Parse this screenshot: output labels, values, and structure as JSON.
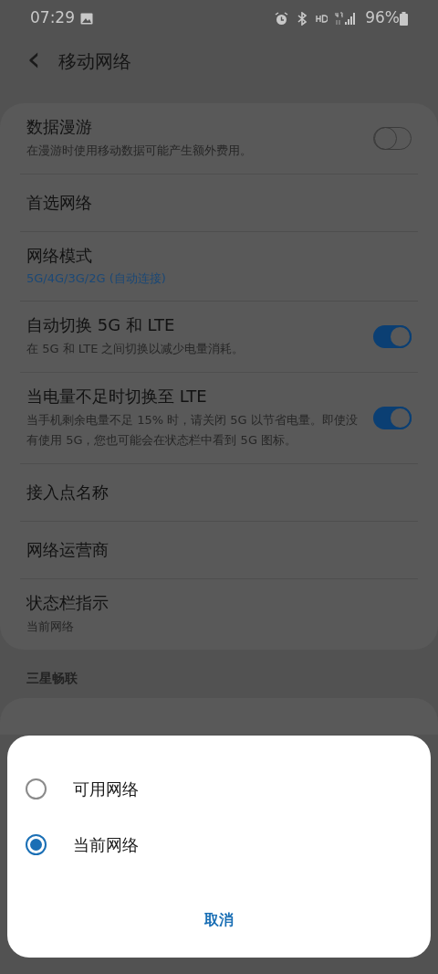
{
  "status_bar": {
    "time": "07:29",
    "battery": "96%"
  },
  "header": {
    "back": "‹",
    "title": "移动网络"
  },
  "settings": [
    {
      "kind": "toggle",
      "title": "数据漫游",
      "subtitle": "在漫游时使用移动数据可能产生额外费用。",
      "on": false
    },
    {
      "kind": "plain",
      "title": "首选网络"
    },
    {
      "kind": "value",
      "title": "网络模式",
      "subtitle": "5G/4G/3G/2G (自动连接)"
    },
    {
      "kind": "toggle",
      "title": "自动切换 5G 和 LTE",
      "subtitle": "在 5G 和 LTE 之间切换以减少电量消耗。",
      "on": true
    },
    {
      "kind": "toggle",
      "title": "当电量不足时切换至 LTE",
      "subtitle": "当手机剩余电量不足 15% 时，请关闭 5G 以节省电量。即使没有使用 5G，您也可能会在状态栏中看到 5G 图标。",
      "on": true
    },
    {
      "kind": "plain",
      "title": "接入点名称"
    },
    {
      "kind": "plain",
      "title": "网络运营商"
    },
    {
      "kind": "summary",
      "title": "状态栏指示",
      "subtitle": "当前网络"
    }
  ],
  "section_header": "三星畅联",
  "dialog": {
    "options": [
      {
        "label": "可用网络",
        "selected": false
      },
      {
        "label": "当前网络",
        "selected": true
      }
    ],
    "cancel": "取消"
  }
}
